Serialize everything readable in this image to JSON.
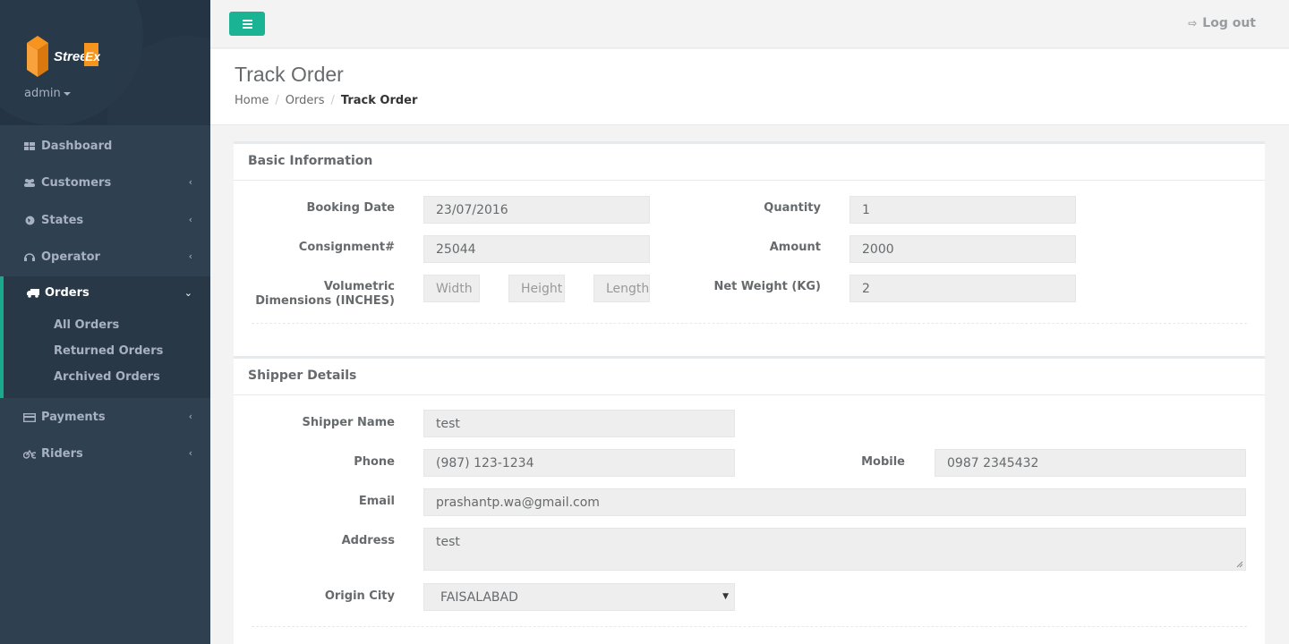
{
  "brand": {
    "logo_text_1": "Street",
    "logo_text_2": "Ex",
    "user": "admin"
  },
  "sidebar": {
    "items": [
      {
        "label": "Dashboard",
        "icon": "grid-icon"
      },
      {
        "label": "Customers",
        "icon": "users-icon"
      },
      {
        "label": "States",
        "icon": "globe-icon"
      },
      {
        "label": "Operator",
        "icon": "headset-icon"
      },
      {
        "label": "Orders",
        "icon": "truck-icon"
      },
      {
        "label": "Payments",
        "icon": "credit-card-icon"
      },
      {
        "label": "Riders",
        "icon": "bicycle-icon"
      }
    ],
    "orders_sub": [
      "All Orders",
      "Returned Orders",
      "Archived Orders"
    ]
  },
  "topbar": {
    "logout_label": "Log out"
  },
  "page": {
    "title": "Track Order",
    "breadcrumb": [
      "Home",
      "Orders",
      "Track Order"
    ]
  },
  "basic": {
    "title": "Basic Information",
    "booking_date_label": "Booking Date",
    "booking_date": "23/07/2016",
    "quantity_label": "Quantity",
    "quantity": "1",
    "consignment_label": "Consignment#",
    "consignment": "25044",
    "amount_label": "Amount",
    "amount": "2000",
    "volumetric_label_1": "Volumetric",
    "volumetric_label_2": "Dimensions (INCHES)",
    "width_placeholder": "Width",
    "height_placeholder": "Height",
    "length_placeholder": "Length",
    "net_weight_label": "Net Weight (KG)",
    "net_weight": "2"
  },
  "shipper": {
    "title": "Shipper Details",
    "name_label": "Shipper Name",
    "name": "test",
    "phone_label": "Phone",
    "phone": "(987) 123-1234",
    "mobile_label": "Mobile",
    "mobile": "0987 2345432",
    "email_label": "Email",
    "email": "prashantp.wa@gmail.com",
    "address_label": "Address",
    "address": "test",
    "origin_city_label": "Origin City",
    "origin_city": "FAISALABAD"
  },
  "colors": {
    "sidebar": "#2f4050",
    "accent": "#1ab394"
  }
}
